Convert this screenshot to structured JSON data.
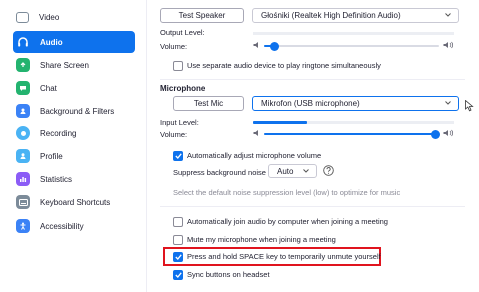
{
  "sidebar": {
    "items": [
      {
        "label": "Video",
        "icon": "video-icon",
        "color": "#7c8b99",
        "active": false
      },
      {
        "label": "Audio",
        "icon": "headphones-icon",
        "color": "#0e72ed",
        "active": true
      },
      {
        "label": "Share Screen",
        "icon": "share-screen-icon",
        "color": "#23b36f",
        "active": false
      },
      {
        "label": "Chat",
        "icon": "chat-icon",
        "color": "#23b36f",
        "active": false
      },
      {
        "label": "Background & Filters",
        "icon": "background-icon",
        "color": "#3b82f6",
        "active": false
      },
      {
        "label": "Recording",
        "icon": "recording-icon",
        "color": "#4ab3f4",
        "active": false
      },
      {
        "label": "Profile",
        "icon": "profile-icon",
        "color": "#4ab3f4",
        "active": false
      },
      {
        "label": "Statistics",
        "icon": "statistics-icon",
        "color": "#8b5cf6",
        "active": false
      },
      {
        "label": "Keyboard Shortcuts",
        "icon": "keyboard-icon",
        "color": "#7c8b99",
        "active": false
      },
      {
        "label": "Accessibility",
        "icon": "accessibility-icon",
        "color": "#3b82f6",
        "active": false
      }
    ]
  },
  "speaker": {
    "test_label": "Test Speaker",
    "device": "Głośniki (Realtek High Definition Audio)",
    "output_level_label": "Output Level:",
    "volume_label": "Volume:",
    "volume": 0.06
  },
  "ringtone_checkbox": {
    "label": "Use separate audio device to play ringtone simultaneously",
    "checked": false
  },
  "microphone": {
    "heading": "Microphone",
    "test_label": "Test Mic",
    "device": "Mikrofon (USB microphone)",
    "input_level_label": "Input Level:",
    "input_level": 0.27,
    "volume_label": "Volume:",
    "volume": 0.98
  },
  "auto_adjust": {
    "label": "Automatically adjust microphone volume",
    "checked": true
  },
  "noise": {
    "label": "Suppress background noise",
    "value": "Auto",
    "hint": "Select the default noise suppression level (low) to optimize for music"
  },
  "options": [
    {
      "label": "Automatically join audio by computer when joining a meeting",
      "checked": false
    },
    {
      "label": "Mute my microphone when joining a meeting",
      "checked": false
    },
    {
      "label": "Press and hold SPACE key to temporarily unmute yourself",
      "checked": true
    },
    {
      "label": "Sync buttons on headset",
      "checked": true
    }
  ],
  "colors": {
    "accent": "#0e72ed",
    "highlight": "#e0141e"
  }
}
